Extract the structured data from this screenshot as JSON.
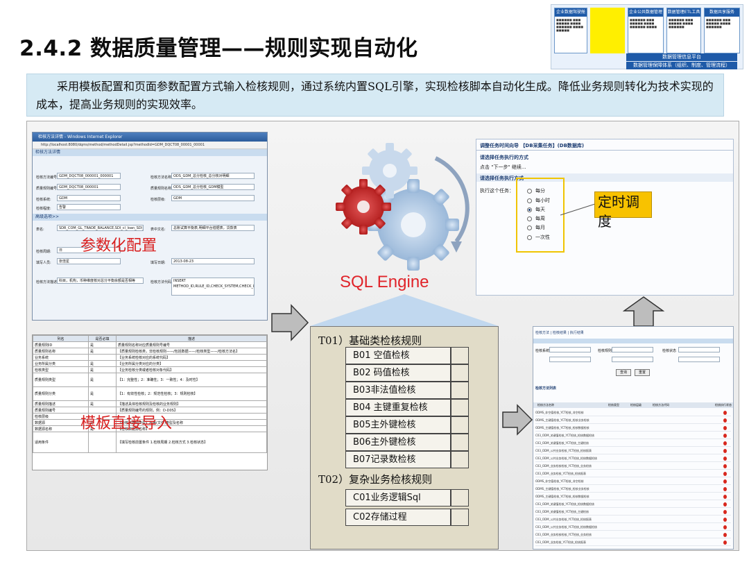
{
  "header": {
    "title": "2.4.2 数据质量管理——规则实现自动化",
    "subtitle": "采用模板配置和页面参数配置方式输入检核规则，通过系统内置SQL引擎，实现检核脚本自动化生成。降低业务规则转化为技术实现的成本，提高业务规则的实现效率。"
  },
  "framework": {
    "cols": [
      "企业数据驾驶舱",
      "企业公共数据管理",
      "数据管理ETL工具",
      "数据共享服务"
    ],
    "platform_label": "数据管理信息平台",
    "system_label": "数据管理保障体系（组织、制度、管理流程）"
  },
  "ie_window": {
    "title": "检核方法详情 - Windows Internet Explorer",
    "address": "http://localhost:8080/dqms/method/methodDetail.jsp?methodId=GDM_DQCT08_00001_00001",
    "section_basic": "检核方法详情",
    "section_advanced": "高级选项>>",
    "fields": [
      {
        "label": "检核方法编号:",
        "value": "GDM_DQCT08_000001_000001"
      },
      {
        "label": "检核方法名称:",
        "value": "ODS_GDM_总分检核_总分核对明细"
      },
      {
        "label": "质量规则编号:",
        "value": "GDM_DQCT08_000001"
      },
      {
        "label": "质量规则名称:",
        "value": "ODS_GDM_总分检核_GDM模型"
      },
      {
        "label": "检核系统:",
        "value": "GDM"
      },
      {
        "label": "检核层级:",
        "value": "GDM"
      },
      {
        "label": "检核程度:",
        "value": "告警"
      },
      {
        "label": "表名:",
        "value": "SDR_COM_GL_TRADE_BALANCE,SDI_cl_loan_SDI_CL_DRAWDOWN"
      },
      {
        "label": "表中文名:",
        "value": "总账试算平衡表,明细平台借据表，贷款表"
      },
      {
        "label": "检核周期:",
        "value": "日"
      },
      {
        "label": "填写人员:",
        "value": "张佳星"
      },
      {
        "label": "填写日期:",
        "value": "2013-08-23"
      },
      {
        "label": "检核方法描述:",
        "value": "科目，机构，币种维度核对总分平衡余额是否相等"
      },
      {
        "label": "检核方法代码:",
        "value": "INSERT METHOD_ID,RULE_ID,CHECK_SYSTEM,CHECK_LAYER,TABLE_N..."
      }
    ],
    "overlay_label": "参数化配置"
  },
  "template": {
    "overlay_label": "模板直接导入",
    "headers": [
      "列名",
      "是否必填",
      "描述"
    ],
    "rows": [
      [
        "质量规则ID",
        "是",
        "质量规则名称对应质量规则号编号"
      ],
      [
        "质量规则名称",
        "是",
        "【质量规则检核类，非检核规则——/包括数据——/检核类型——/检核方法名】"
      ],
      [
        "业务系统",
        "",
        "【业务系统检核对应的系统代码】"
      ],
      [
        "业务所属分类",
        "是",
        "【业务所属分类对应的分类】"
      ],
      [
        "检核类型",
        "是",
        "【业务检核分类或者检核对象代码】"
      ],
      [
        "质量规则类型",
        "是",
        "【1：完整性；2：准确性；3：一致性；4：及时性】"
      ],
      [
        "质量规则分类",
        "是",
        "【1：有效性检核；2：规范性检核；3：规则检核】"
      ],
      [
        "质量规则描述",
        "是",
        "【描述具体检核规则及检核的业务规则】"
      ],
      [
        "质量规则编号",
        "",
        "【质量规则编号的规则，例：D-D0S】"
      ],
      [
        "检核层级",
        "",
        ""
      ],
      [
        "数据源",
        "是",
        "【检核数据源类型】表格(文件)类型及名称"
      ],
      [
        "数据源名称",
        "是",
        "【检核数据源名称】"
      ],
      [
        "适用条件",
        "",
        "【填写检核前置条件 1.检核周期 2.检核方式 3.检核状态】"
      ]
    ]
  },
  "engine": {
    "label": "SQL Engine"
  },
  "rules": {
    "cat1": "T01）基础类检核规则",
    "basic": [
      "B01 空值检核",
      "B02 码值检核",
      "B03非法值检核",
      "B04 主键重复检核",
      "B05主外键检核",
      "B06主外键检核",
      "B07记录数检核"
    ],
    "cat2": "T02）复杂业务检核规则",
    "complex": [
      "C01业务逻辑Sql",
      "C02存储过程"
    ]
  },
  "schedule": {
    "wizard_title": "调整任务时间向导 【DB采集任务】(DB数据库)",
    "step_label": "请选择任务执行的方式",
    "hint": "点击 \"下一步\" 继续...",
    "section2": "请选择任务执行方式",
    "exec_label": "执行这个任务：",
    "options": [
      "每分",
      "每小时",
      "每天",
      "每周",
      "每月",
      "一次性"
    ],
    "selected": "每天",
    "callout": "定时调度"
  },
  "result_page": {
    "tabs": [
      "检核方法",
      "检核结果",
      "执行结果"
    ],
    "filters": [
      "检核系统",
      "检核规则",
      "检核状态"
    ],
    "query_button": "查询",
    "reset_button": "重置",
    "list_title": "检核方法列表",
    "list_headers": [
      "检核方法名称",
      "检核类型",
      "检核层级",
      "检核方法代码",
      "检核执行状态"
    ],
    "rows": [
      "ODMS_非空值检核_YCT检核_非空检核",
      "ODMS_主键值检核_YCT检核_检核业务检核",
      "ODMS_主键值检核_YCT检核_检核数据检核",
      "C03_ODM_关键值检核_YCT检核_检核数据检核",
      "C03_ODM_关键值检核_YCT检核_主键检核",
      "C03_ODM_公共业务检核_YCT检核_检核报表",
      "C03_ODM_公共业务检核_YCT检核_检核数据检核",
      "C03_ODM_业务检核检核_YCT检核_业务检核",
      "C03_ODM_业务检核_YCT检核_检核报表",
      "ODMS_非空值检核_YCT检核_非空检核",
      "ODMS_主键值检核_YCT检核_检核业务检核",
      "ODMS_主键值检核_YCT检核_检核数据检核",
      "C03_ODM_关键值检核_YCT检核_检核数据检核",
      "C03_ODM_关键值检核_YCT检核_主键检核",
      "C03_ODM_公共业务检核_YCT检核_检核报表",
      "C03_ODM_公共业务检核_YCT检核_检核数据检核",
      "C03_ODM_业务检核检核_YCT检核_业务检核",
      "C03_ODM_业务检核_YCT检核_检核报表"
    ]
  },
  "colors": {
    "accent_red": "#d92020",
    "callout_yellow": "#f8c200",
    "header_blue": "#1e5aa8",
    "rules_bg": "#e1dcc8"
  }
}
